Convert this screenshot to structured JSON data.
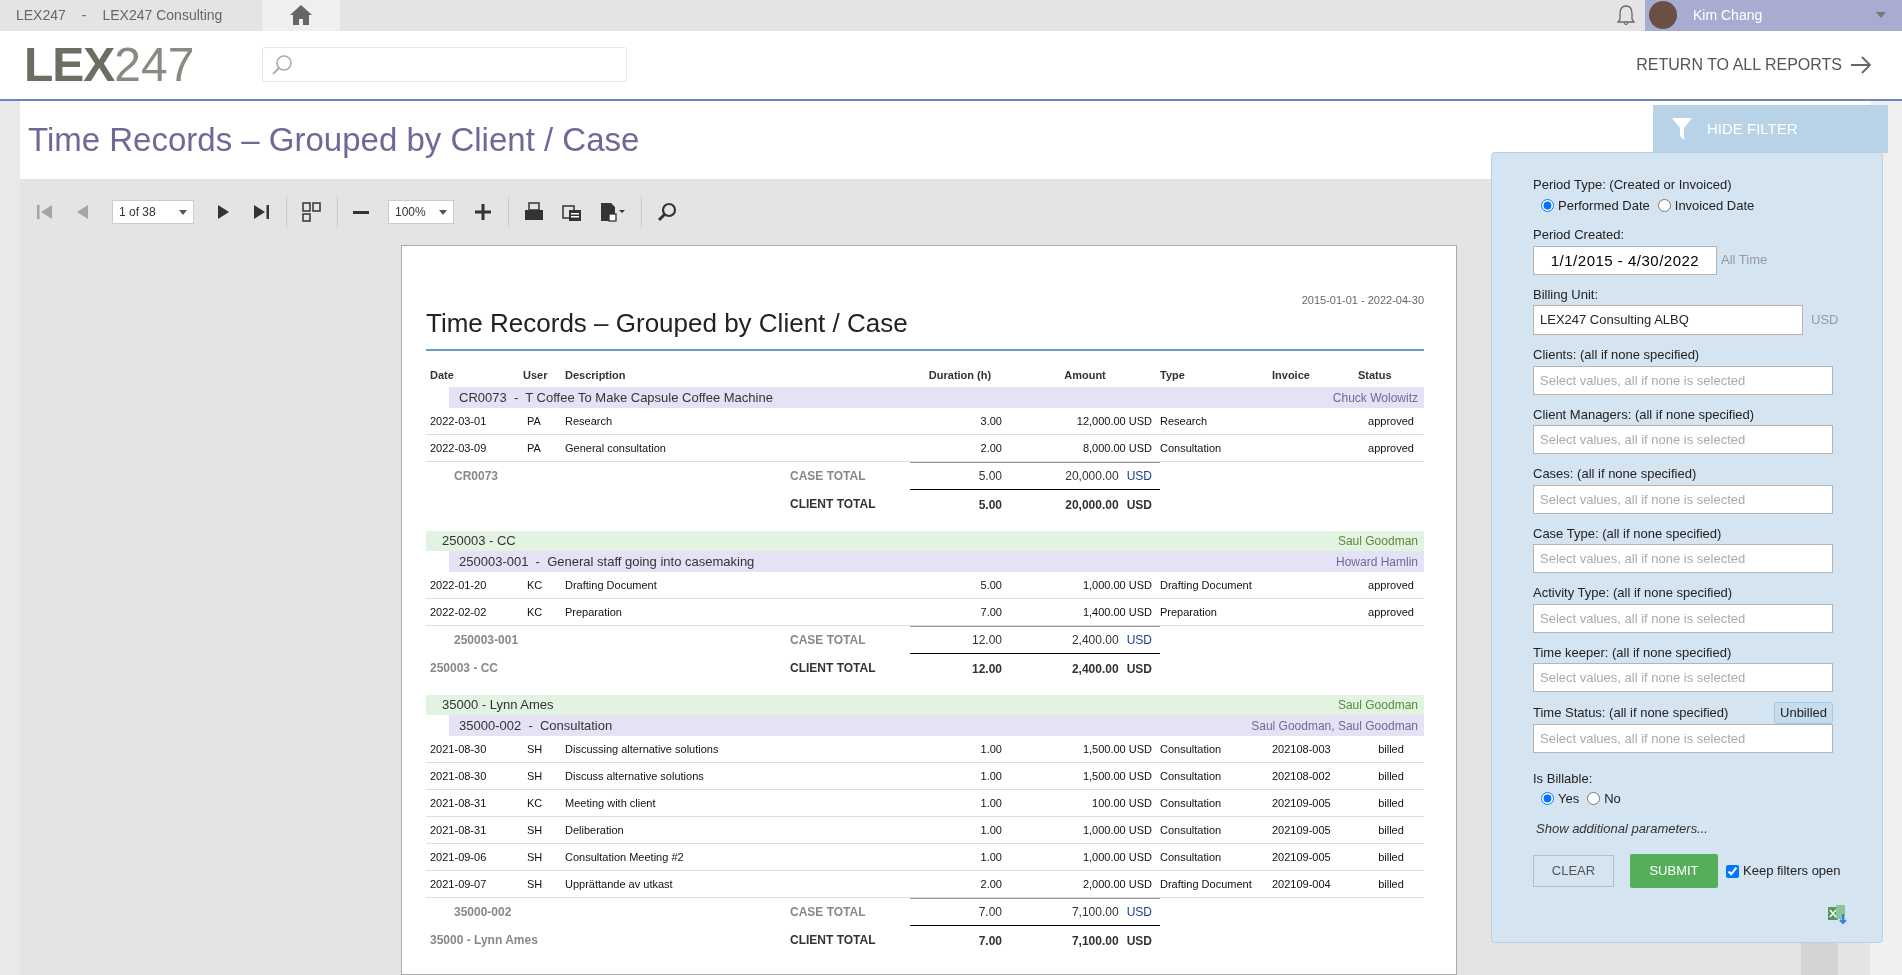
{
  "top_bar": {
    "app": "LEX247",
    "separator": "-",
    "company": "LEX247 Consulting",
    "user": "Kim Chang"
  },
  "header": {
    "logo": {
      "main": "LEX",
      "suffix": "247"
    },
    "return_link": "RETURN TO ALL REPORTS"
  },
  "page_title": "Time Records – Grouped by Client / Case",
  "toolbar": {
    "buttons": [
      {
        "kind": "first",
        "disabled": true
      },
      {
        "kind": "prev",
        "disabled": true
      },
      {
        "kind": "page-select",
        "value": "1 of 38"
      },
      {
        "kind": "next",
        "disabled": false
      },
      {
        "kind": "last",
        "disabled": false
      },
      {
        "kind": "sep"
      },
      {
        "kind": "multipage",
        "disabled": false
      },
      {
        "kind": "sep"
      },
      {
        "kind": "zoom-out",
        "disabled": false
      },
      {
        "kind": "zoom-select",
        "value": "100%"
      },
      {
        "kind": "zoom-in",
        "disabled": false
      },
      {
        "kind": "sep"
      },
      {
        "kind": "print",
        "disabled": false
      },
      {
        "kind": "print-page",
        "disabled": false
      },
      {
        "kind": "export",
        "disabled": false
      },
      {
        "kind": "sep"
      },
      {
        "kind": "search",
        "disabled": false
      }
    ]
  },
  "report": {
    "title": "Time Records – Grouped by Client / Case",
    "date_range": "2015-01-01 - 2022-04-30",
    "columns": [
      "Date",
      "User",
      "Description",
      "Duration (h)",
      "Amount",
      "Type",
      "Invoice",
      "Status"
    ],
    "clients": [
      {
        "cases": [
          {
            "heading": "CR0073  -  T Coffee To Make Capsule Coffee Machine",
            "managers": "Chuck Wolowitz",
            "rows": [
              [
                "2022-03-01",
                "PA",
                "Research",
                "3.00",
                "12,000.00 USD",
                "Research",
                "",
                "approved"
              ],
              [
                "2022-03-09",
                "PA",
                "General consultation",
                "2.00",
                "8,000.00 USD",
                "Consultation",
                "",
                "approved"
              ]
            ],
            "total": {
              "code": "CR0073",
              "label": "CASE TOTAL",
              "duration": "5.00",
              "amount": "20,000.00",
              "currency": "USD"
            }
          }
        ],
        "total": {
          "label": "CLIENT TOTAL",
          "duration": "5.00",
          "amount": "20,000.00",
          "currency": "USD"
        }
      },
      {
        "heading": {
          "name": "250003 - CC",
          "manager": "Saul Goodman"
        },
        "cases": [
          {
            "heading": "250003-001  -  General staff going into casemaking",
            "managers": "Howard Hamlin",
            "rows": [
              [
                "2022-01-20",
                "KC",
                "Drafting Document",
                "5.00",
                "1,000.00 USD",
                "Drafting Document",
                "",
                "approved"
              ],
              [
                "2022-02-02",
                "KC",
                "Preparation",
                "7.00",
                "1,400.00 USD",
                "Preparation",
                "",
                "approved"
              ]
            ],
            "total": {
              "code": "250003-001",
              "label": "CASE TOTAL",
              "duration": "12.00",
              "amount": "2,400.00",
              "currency": "USD"
            }
          }
        ],
        "total": {
          "code": "250003 - CC",
          "label": "CLIENT TOTAL",
          "duration": "12.00",
          "amount": "2,400.00",
          "currency": "USD"
        }
      },
      {
        "heading": {
          "name": "35000 - Lynn Ames",
          "manager": "Saul Goodman"
        },
        "cases": [
          {
            "heading": "35000-002  -  Consultation",
            "managers": "Saul Goodman, Saul Goodman",
            "rows": [
              [
                "2021-08-30",
                "SH",
                "Discussing alternative solutions",
                "1.00",
                "1,500.00 USD",
                "Consultation",
                "202108-003",
                "billed"
              ],
              [
                "2021-08-30",
                "SH",
                "Discuss alternative solutions",
                "1.00",
                "1,500.00 USD",
                "Consultation",
                "202108-002",
                "billed"
              ],
              [
                "2021-08-31",
                "KC",
                "Meeting with client",
                "1.00",
                "100.00 USD",
                "Consultation",
                "202109-005",
                "billed"
              ],
              [
                "2021-08-31",
                "SH",
                "Deliberation",
                "1.00",
                "1,000.00 USD",
                "Consultation",
                "202109-005",
                "billed"
              ],
              [
                "2021-09-06",
                "SH",
                "Consultation Meeting #2",
                "1.00",
                "1,000.00 USD",
                "Consultation",
                "202109-005",
                "billed"
              ],
              [
                "2021-09-07",
                "SH",
                "Upprättande av utkast",
                "2.00",
                "2,000.00 USD",
                "Drafting Document",
                "202109-004",
                "billed"
              ]
            ],
            "total": {
              "code": "35000-002",
              "label": "CASE TOTAL",
              "duration": "7.00",
              "amount": "7,100.00",
              "currency": "USD"
            }
          }
        ],
        "total": {
          "code": "35000 - Lynn Ames",
          "label": "CLIENT TOTAL",
          "duration": "7.00",
          "amount": "7,100.00",
          "currency": "USD"
        }
      }
    ]
  },
  "filter": {
    "toggle": "HIDE FILTER",
    "period_type": {
      "label": "Period Type: (Created or Invoiced)",
      "options": [
        {
          "label": "Performed Date",
          "selected": true
        },
        {
          "label": "Invoiced Date",
          "selected": false
        }
      ]
    },
    "period_created": {
      "label": "Period Created:",
      "value": "1/1/2015 - 4/30/2022",
      "hint": "All Time"
    },
    "billing_unit": {
      "label": "Billing Unit:",
      "value": "LEX247 Consulting ALBQ",
      "currency": "USD"
    },
    "multi_selects": [
      {
        "label": "Clients: (all if none specified)",
        "placeholder": "Select values, all if none is selected"
      },
      {
        "label": "Client Managers: (all if none specified)",
        "placeholder": "Select values, all if none is selected"
      },
      {
        "label": "Cases: (all if none specified)",
        "placeholder": "Select values, all if none is selected"
      },
      {
        "label": "Case Type: (all if none specified)",
        "placeholder": "Select values, all if none is selected"
      },
      {
        "label": "Activity Type: (all if none specified)",
        "placeholder": "Select values, all if none is selected"
      },
      {
        "label": "Time keeper: (all if none specified)",
        "placeholder": "Select values, all if none is selected"
      },
      {
        "label": "Time Status: (all if none specified)",
        "placeholder": "Select values, all if none is selected",
        "tag": "Unbilled"
      }
    ],
    "is_billable": {
      "label": "Is Billable:",
      "options": [
        {
          "label": "Yes",
          "selected": true
        },
        {
          "label": "No",
          "selected": false
        }
      ]
    },
    "more_link": "Show additional parameters...",
    "clear": "CLEAR",
    "submit": "SUBMIT",
    "keep_open": {
      "label": "Keep filters open",
      "checked": true
    }
  }
}
